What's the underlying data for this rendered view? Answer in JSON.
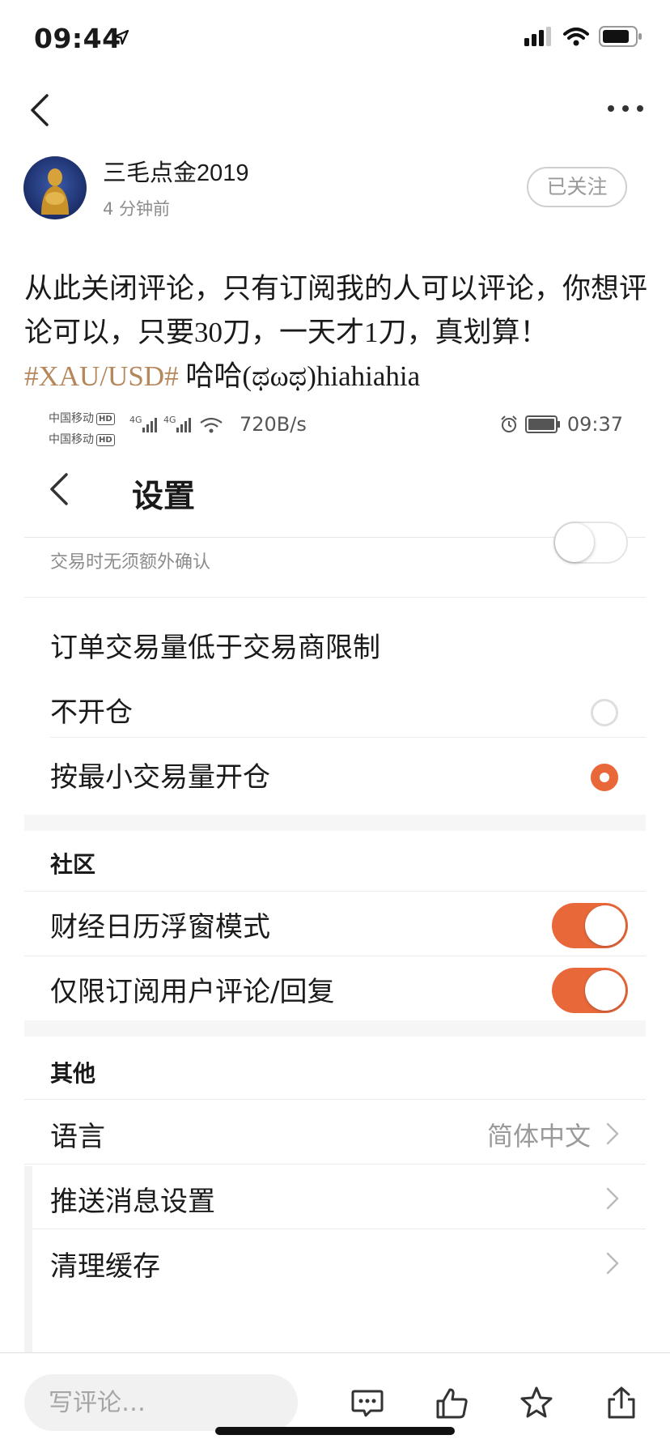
{
  "status_bar": {
    "time": "09:44"
  },
  "nav": {
    "back_icon": "chevron-left-icon",
    "more_icon": "more-icon"
  },
  "author": {
    "name": "三毛点金2019",
    "time_ago": "4 分钟前",
    "follow_label": "已关注"
  },
  "post": {
    "text_before": "从此关闭评论，只有订阅我的人可以评论，你想评论可以，只要30刀，一天才1刀，真划算！",
    "hashtag": "#XAU/USD#",
    "text_after": " 哈哈(ಥωಥ)hiahiahia"
  },
  "embedded": {
    "status": {
      "carrier1": "中国移动",
      "carrier2": "中国移动",
      "hd": "HD",
      "net": "4G",
      "speed": "720B/s",
      "time": "09:37"
    },
    "title": "设置",
    "trade_confirm_desc": "交易时无须额外确认",
    "order_section": {
      "title": "订单交易量低于交易商限制",
      "options": [
        {
          "label": "不开仓",
          "selected": false
        },
        {
          "label": "按最小交易量开仓",
          "selected": true
        }
      ]
    },
    "community": {
      "title": "社区",
      "items": [
        {
          "label": "财经日历浮窗模式",
          "enabled": true
        },
        {
          "label": "仅限订阅用户评论/回复",
          "enabled": true
        }
      ]
    },
    "other": {
      "title": "其他",
      "items": [
        {
          "label": "语言",
          "value": "简体中文"
        },
        {
          "label": "推送消息设置",
          "value": ""
        },
        {
          "label": "清理缓存",
          "value": ""
        }
      ]
    }
  },
  "bottom_bar": {
    "comment_placeholder": "写评论…",
    "icons": [
      "comment-icon",
      "like-icon",
      "star-icon",
      "share-icon"
    ]
  },
  "colors": {
    "accent": "#e9683a",
    "hashtag": "#b5875a"
  }
}
